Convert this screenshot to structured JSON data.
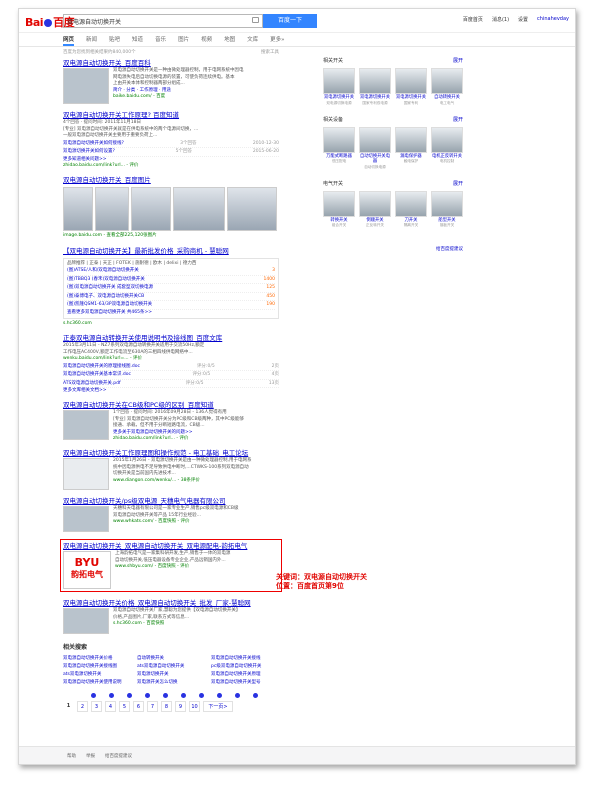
{
  "header": {
    "logo_bai": "Bai",
    "logo_du": "百度",
    "query": "双电源自动切换开关",
    "search_btn": "百度一下",
    "toplinks": [
      "百度首页",
      "消息(1)",
      "设置",
      "chinahevday"
    ]
  },
  "tabs": [
    "网页",
    "新闻",
    "贴吧",
    "知道",
    "音乐",
    "图片",
    "视频",
    "地图",
    "文库",
    "更多»"
  ],
  "tip": {
    "count": "百度为您找到相关结果约840,000个",
    "tools": "搜索工具"
  },
  "results": [
    {
      "title": "双电源自动切换开关_百度百科",
      "desc1": "双电源自动切换开关是一种由微处理器控制，用于电网系统中因电",
      "desc2": "网电源失电后自动切换电源的装置，可使负荷连续供电。基本",
      "desc3": "上由开关本体和控制器两部分组成...",
      "links": "简介 · 分类 · 工作原理 · 用途",
      "url": "baike.baidu.com/ - 百度"
    },
    {
      "title": "双电源自动切换开关工作原理? 百度知道",
      "meta": "4个回答 · 提问时间: 2011年11月18日",
      "desc1": "[专业] 双电源自动切换开关就是在供电系统中的两个电源间切换，...",
      "desc2": "一般双电源自动切换开关主要用于重要负荷上...",
      "q1": "双电源自动切换开关如何接线?",
      "q1c": "3个回答",
      "q1d": "2010-12-30",
      "q2": "双电源切换开关如何设置?",
      "q2c": "5个回答",
      "q2d": "2015-06-20",
      "more": "更多知道相关问题>>",
      "url": "zhidao.baidu.com/link?url... - 评价"
    },
    {
      "title": "双电源自动切换开关_百度图片",
      "url": "image.baidu.com - 查看全部225,120张图片"
    },
    {
      "title": "【双电源自动切换开关】最新批发价格_采购商机 - 慧聪网",
      "phead": "品牌推荐 | 正泰 | 天正 | FOTEK | 施耐德 | 欧木 | delixi | 德力西",
      "items": [
        {
          "name": "(图)ATSE/人和/双电源自动切换开关",
          "price": "3"
        },
        {
          "name": "(图)TBBQ3 (春禾)双电源自动切换开关",
          "price": "1400"
        },
        {
          "name": "(图)双电源自动切换开关 成套型双切换电源",
          "price": "125"
        },
        {
          "name": "(图)泰博电子、双电源自动切换开关CB",
          "price": "450"
        },
        {
          "name": "(图)凯隆QSM1-63/3P双电源自动切换开关",
          "price": "190"
        }
      ],
      "more": "查看更多双电源自动切换开关 共465条>>",
      "url": "s.hc360.com"
    },
    {
      "title": "正泰双电源自动转换开关使用说明书及接线图_百度文库",
      "desc1": "2015年3月11日 - NZ7系列双电源自动转换开关适用于交流50Hz,额定",
      "desc2": "工作电压AC400V,额定工作电流至630A的三相四线供电网络中...",
      "url": "wenku.baidu.com/link?url=... - 评价",
      "docs": [
        {
          "name": "双电源自动切换开关的原理接线图.doc",
          "score": "评分:0/5",
          "pages": "2页"
        },
        {
          "name": "双电源自动切换开关基本常识.doc",
          "score": "评分:0/5",
          "pages": "4页"
        },
        {
          "name": "ATS双电源自动切换开关.pdf",
          "score": "评分:0/5",
          "pages": "13页"
        }
      ],
      "more": "更多文库相关文档>>"
    },
    {
      "title": "双电源自动切换开关在CB级和PC级的区别_百度知道",
      "meta": "1个回答 · 提问时间: 2016年09月28日 - 136人觉得有用",
      "desc1": "[专业] 双电源自动切换开关分为PC级和CB级两种，其中PC级能够",
      "desc2": "接通、承载，但不用于分断短路电流，CB级...",
      "more": "更多关于双电源自动切换开关的问题>>",
      "url": "zhidao.baidu.com/link?url... - 评价"
    },
    {
      "title": "双电源自动切换开关工作原理图和操作规范 - 电工基础_电工论坛",
      "desc1": "2015年1月26日 - 双电源切换开关是由一种微处理器控制,用于电网系",
      "desc2": "统中因电源供电不足导致供电中断时,...CTWKS-100系列双电源自动",
      "desc3": "切换开关是当前国内先进技术...",
      "url": "www.diangon.com/wenku/... - 38条评价"
    },
    {
      "title": "双电源自动切换开关/ps级双电源_天穗电气电器有限公司",
      "desc1": "天穗科天电器有限公司是一家专业生产,销售pc级双电源和CB级",
      "desc2": "双电源自动切换开关等产品 15年行业经验...",
      "url": "www.whkats.com/ - 百度快照 - 评价"
    },
    {
      "title": "双电源自动切换开关_双电源自动切换开关_双电源配电-韵拓电气",
      "desc1": "上海韵拓电气是一家集科研开发,生产,销售于一体的双电源",
      "desc2": "自动切换开关,低压电器设备专业企业,产品远销国内外...",
      "url": "www.shbyu.com/ - 百度快照 - 评价",
      "logo_top": "BYU",
      "logo_bottom": "韵拓电气"
    },
    {
      "title": "双电源自动切换开关价格_双电源自动切换开关_批发_厂家-慧聪网",
      "desc1": "双电源自动切换开关厂家,慧聪为您提供【双电源自动切换开关】",
      "desc2": "价格,产品图片,厂家,联系方式等信息...",
      "url": "s.hc360.com - 百度快照"
    }
  ],
  "annotation": {
    "line1": "关键词：双电源自动切换开关",
    "line2": "位置：百度首页第9位"
  },
  "related": {
    "title": "相关搜索",
    "items": [
      "双电源自动切换开关价格",
      "自动转换开关",
      "双电源自动切换开关接线",
      "双电源自动切换开关接线图",
      "ats双电源自动切换开关",
      "pc级双电源自动切换开关",
      "ats双电源切换开关",
      "双电源切换开关",
      "双电源自动切换开关原理",
      "双电源自动切换开关使用说明",
      "双电源开关怎么切换",
      "双电源自动切换开关型号"
    ]
  },
  "pager": {
    "pages": [
      "1",
      "2",
      "3",
      "4",
      "5",
      "6",
      "7",
      "8",
      "9",
      "10"
    ],
    "current": "1",
    "next": "下一页>"
  },
  "footer": [
    "帮助",
    "举报",
    "给百度提建议"
  ],
  "sidebar": {
    "sections": [
      {
        "title": "相关开关",
        "expand": "展开",
        "items": [
          {
            "label": "双电源切换开关",
            "sub": "双电源切换电源"
          },
          {
            "label": "双电源切换开关",
            "sub": "国家专利双电源"
          },
          {
            "label": "双电源切换开关",
            "sub": "国家专利"
          },
          {
            "label": "自动转换开关",
            "sub": "电工电气"
          }
        ]
      },
      {
        "title": "相关设备",
        "expand": "展开",
        "items": [
          {
            "label": "万能式断路器",
            "sub": "低压配电"
          },
          {
            "label": "自动切换开关电器",
            "sub": "自动切换电源"
          },
          {
            "label": "漏电保护器",
            "sub": "触电保护"
          },
          {
            "label": "电机正反转开关",
            "sub": "电机控制"
          }
        ]
      },
      {
        "title": "电气开关",
        "expand": "展开",
        "items": [
          {
            "label": "转换开关",
            "sub": "组合开关"
          },
          {
            "label": "倒顺开关",
            "sub": "正反转开关"
          },
          {
            "label": "刀开关",
            "sub": "隔离开关"
          },
          {
            "label": "船型开关",
            "sub": "翘板开关"
          }
        ]
      }
    ],
    "feedback": "给百度提建议"
  }
}
